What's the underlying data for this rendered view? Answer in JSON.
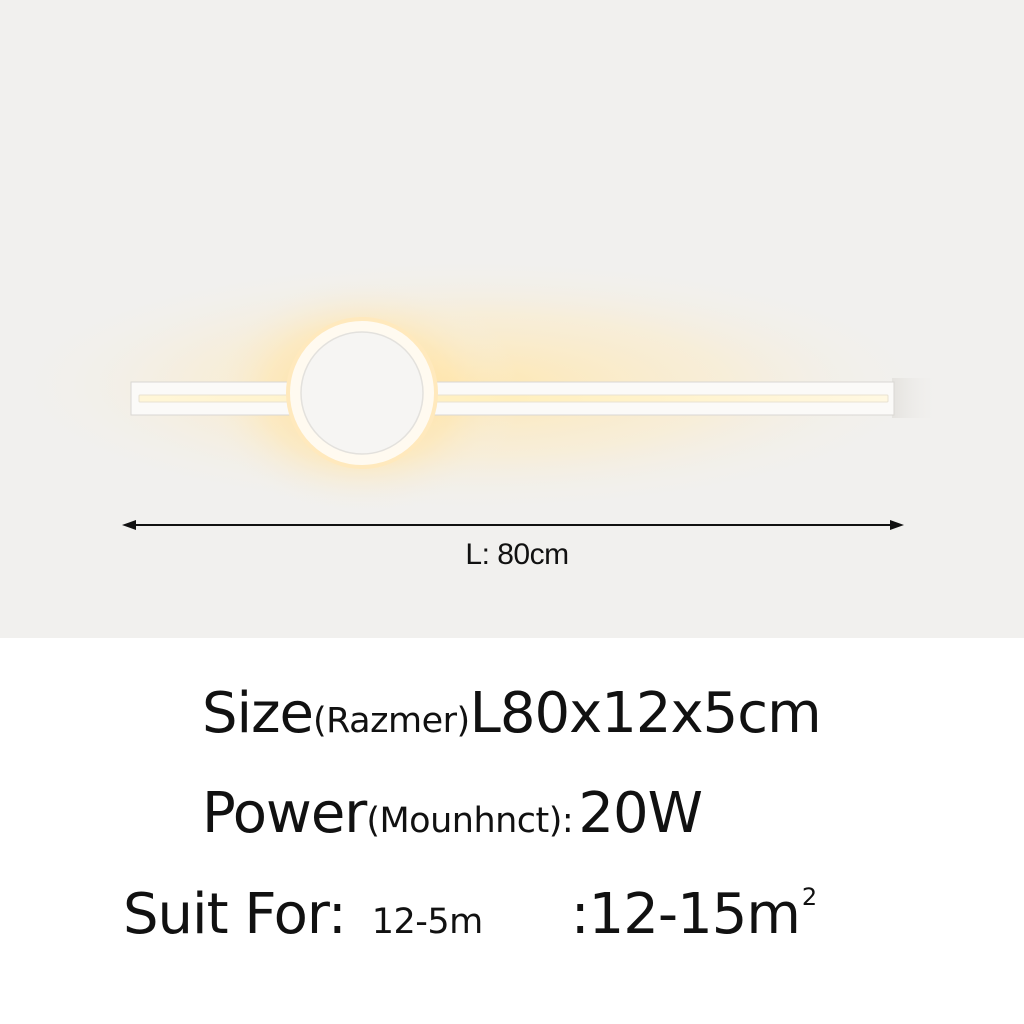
{
  "dimension_label": "L: 80cm",
  "specs": {
    "size": {
      "label": "Size",
      "sub": "(Razmer)",
      "value": "L80x12x5cm"
    },
    "power": {
      "label": "Power",
      "sub": "(Mounhnct):",
      "value": "20W"
    },
    "suit": {
      "label": "Suit For:",
      "sub": "12-5m",
      "value": ":12-15m",
      "sup": "2"
    }
  },
  "colors": {
    "photo_background": "#f1f0ee",
    "lamp_white": "#fbfaf8",
    "glow": "#ffe9b0",
    "text": "#111111"
  }
}
